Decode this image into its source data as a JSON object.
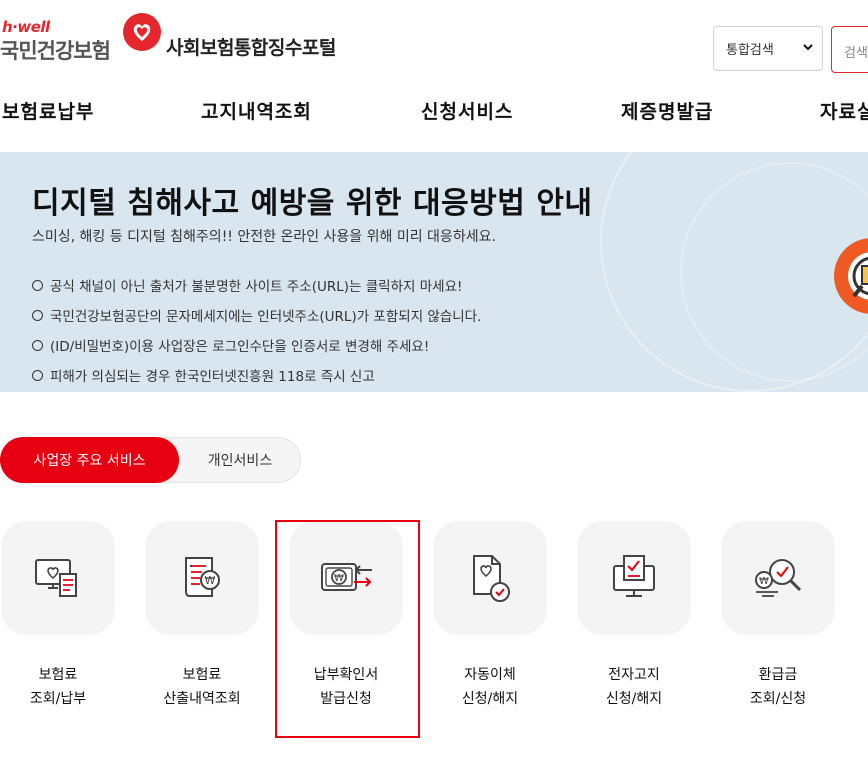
{
  "header": {
    "logo_sub": "h·well",
    "logo_main": "국민건강보험",
    "portal_title": "사회보험통합징수포털",
    "search_select": "통합검색",
    "search_placeholder": "검색"
  },
  "gnb": [
    "보험료납부",
    "고지내역조회",
    "신청서비스",
    "제증명발급",
    "자료실"
  ],
  "banner": {
    "title": "디지털 침해사고 예방을 위한 대응방법 안내",
    "subtitle": "스미싱, 해킹 등 디지털 침해주의!! 안전한 온라인 사용을 위해 미리 대응하세요.",
    "items": [
      "공식 채널이 아닌 출처가 불분명한 사이트 주소(URL)는 클릭하지 마세요!",
      "국민건강보험공단의 문자메세지에는 인터넷주소(URL)가 포함되지 않습니다.",
      "(ID/비밀번호)이용 사업장은 로그인수단을 인증서로 변경해 주세요!",
      "피해가 의심되는 경우 한국인터넷진흥원 118로 즉시 신고"
    ]
  },
  "tabs": {
    "active": "사업장 주요 서비스",
    "inactive": "개인서비스"
  },
  "services": [
    {
      "line1": "보험료",
      "line2": "조회/납부",
      "icon": "monitor-heart-receipt-icon"
    },
    {
      "line1": "보험료",
      "line2": "산출내역조회",
      "icon": "document-won-icon"
    },
    {
      "line1": "납부확인서",
      "line2": "발급신청",
      "icon": "card-won-arrows-icon"
    },
    {
      "line1": "자동이체",
      "line2": "신청/해지",
      "icon": "document-heart-check-icon"
    },
    {
      "line1": "전자고지",
      "line2": "신청/해지",
      "icon": "monitor-check-icon"
    },
    {
      "line1": "환급금",
      "line2": "조회/신청",
      "icon": "coin-magnifier-check-icon"
    }
  ],
  "colors": {
    "accent": "#e60012",
    "banner_bg": "#dae6ef",
    "card_bg": "#f4f4f4"
  }
}
